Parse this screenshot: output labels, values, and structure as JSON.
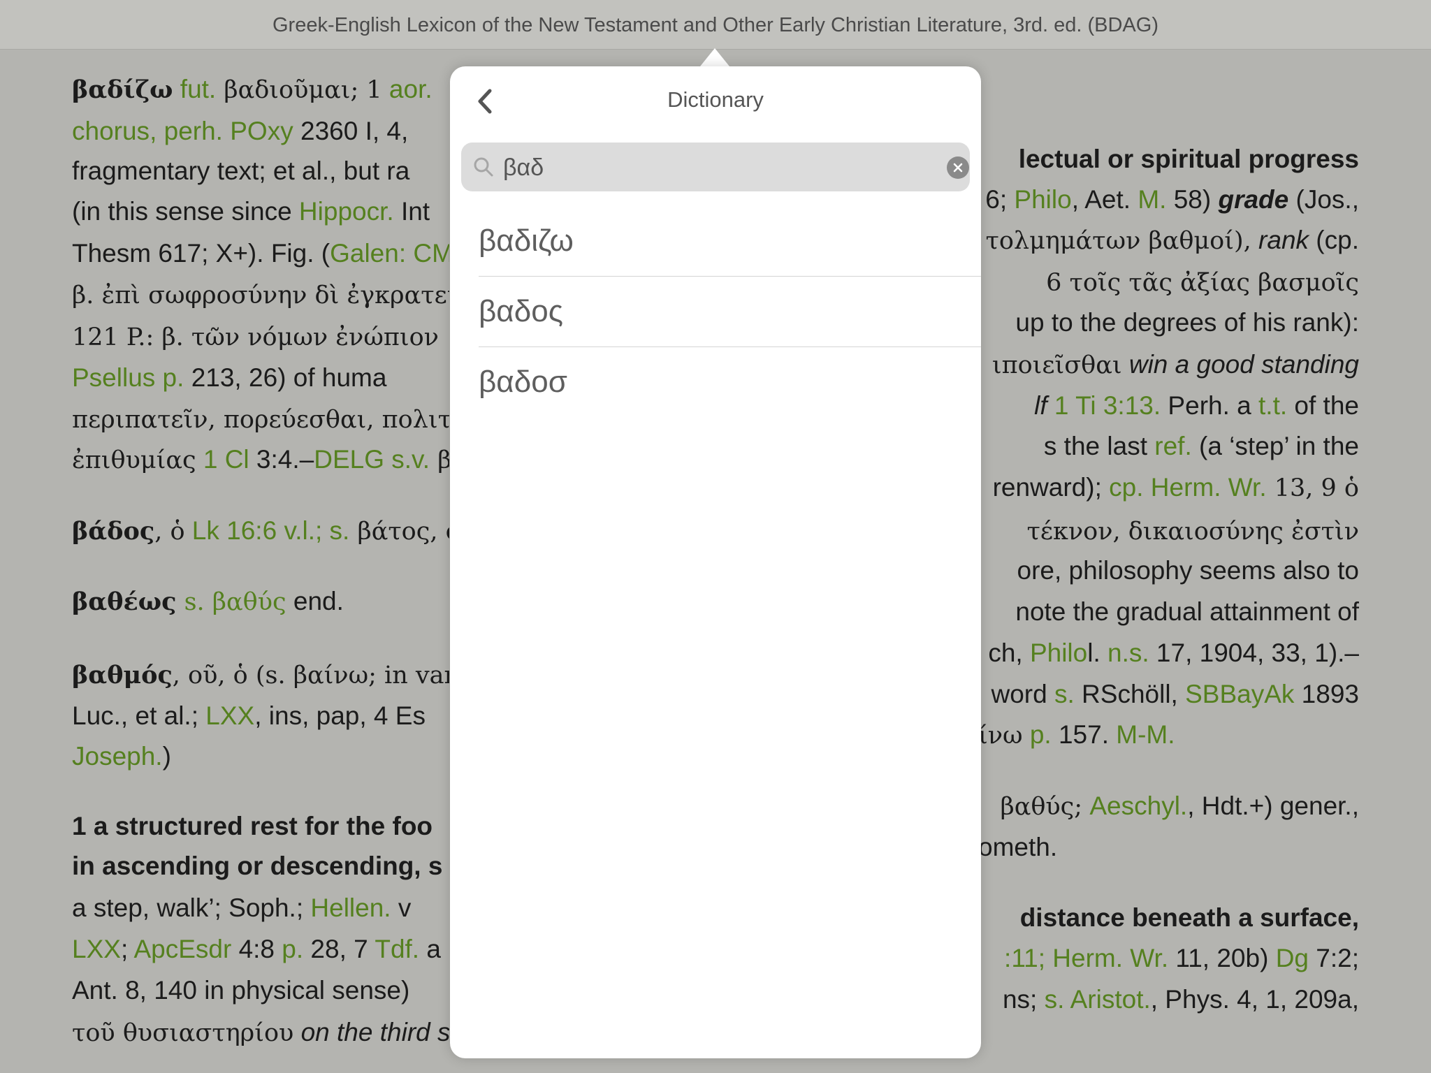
{
  "header": {
    "title": "Greek-English Lexicon of the New Testament and Other Early Christian Literature, 3rd. ed.  (BDAG)"
  },
  "left_column": [
    [
      "βαδίζω",
      " fut.",
      " βαδιοῦμαι; 1",
      " aor."
    ],
    [
      "chorus",
      ", perh.",
      " POxy",
      " 2360 I, 4,"
    ],
    [
      "fragmentary text; et al., but ra"
    ],
    [
      "(in this sense since",
      " Hippocr.",
      " Int"
    ],
    [
      "Thesm 617; X+). Fig. (",
      "Galen",
      ": CM"
    ],
    [
      "β. ἐπὶ σωφροσύνην δὶ ἐγκρατεί"
    ],
    [
      "121 P.: β. τῶν νόμων ἐνώπιον"
    ],
    [
      "Psellus",
      " p.",
      " 213, 26) of huma"
    ],
    [
      "περιπατεῖν, πορεύεσθαι, πολιτεῦ"
    ],
    [
      "ἐπιθυμίας",
      " 1 Cl",
      " 3:4.–",
      "DELG s.v.",
      " βαί"
    ],
    [
      "βάδος",
      ", ὁ",
      " Lk 16:6 v.l.; s.",
      " βάτος, ὁ."
    ],
    [
      "βαθέως",
      " s. βαθύς",
      " end."
    ],
    [
      "βαθμός",
      ", οῦ, ὁ (s. βαίνω; in vari"
    ],
    [
      "Luc., et al.;",
      " LXX",
      ", ins, pap, 4 Es"
    ],
    [
      "Joseph.",
      ")"
    ],
    [
      "1 a structured rest for the foo"
    ],
    [
      "in ascending or descending, s"
    ],
    [
      "a step, walk’; Soph.;",
      " Hellen.",
      " v"
    ],
    [
      "LXX",
      ";",
      " ApcEsdr",
      " 4:8",
      " p.",
      " 28, 7",
      " Tdf.",
      " a"
    ],
    [
      "Ant. 8, 140 in physical sense)"
    ],
    [
      "τοῦ θυσιαστηρίου",
      " on the third s"
    ]
  ],
  "right_column": [
    [
      "lectual or spiritual progress"
    ],
    [
      "6;",
      " Philo",
      ", Aet.",
      " M.",
      " 58)",
      " grade",
      " (Jos.,"
    ],
    [
      "τολμημάτων βαθμοί),",
      " rank",
      " (cp."
    ],
    [
      "6 τοῖς τᾶς ἀξίας βασμοῖς"
    ],
    [
      "up to the degrees of his rank):"
    ],
    [
      "ιποιεῖσθαι",
      " win a good standing"
    ],
    [
      "lf",
      " 1 Ti 3:13.",
      " Perh. a",
      " t.t.",
      " of the"
    ],
    [
      "s the last",
      " ref.",
      " (a ‘step’ in the"
    ],
    [
      "renward);",
      " cp. Herm. Wr.",
      " 13, 9 ὁ"
    ],
    [
      "τέκνον, δικαιοσύνης ἐστὶν"
    ],
    [
      "ore, philosophy seems also to"
    ],
    [
      "note the gradual attainment of"
    ],
    [
      "ch,",
      " Philo",
      "l.",
      " n.s.",
      " 17, 1904, 33, 1).–"
    ],
    [
      "word",
      " s.",
      " RSchöll,",
      " SBBayAk",
      " 1893"
    ],
    [
      "ίνω",
      " p.",
      " 157.",
      " M-M."
    ],
    [
      "βαθύς;",
      " Aeschyl.",
      ", Hdt.+) gener.,"
    ],
    [
      "ometh."
    ],
    [
      "distance beneath a surface,"
    ],
    [
      ":11; Herm. Wr.",
      " 11, 20b)",
      " Dg",
      " 7:2;"
    ],
    [
      "ns;",
      " s. Aristot.",
      ", Phys. 4, 1, 209a,"
    ]
  ],
  "dictionary": {
    "title": "Dictionary",
    "search_value": "βαδ",
    "results": [
      "βαδιζω",
      "βαδος",
      "βαδοσ"
    ],
    "icons": {
      "back": "chevron-left-icon",
      "search": "search-icon",
      "clear": "clear-icon"
    }
  },
  "colors": {
    "background": "#b4b4b0",
    "link": "#55801f",
    "text": "#1b1b1b",
    "popover": "#ffffff"
  }
}
